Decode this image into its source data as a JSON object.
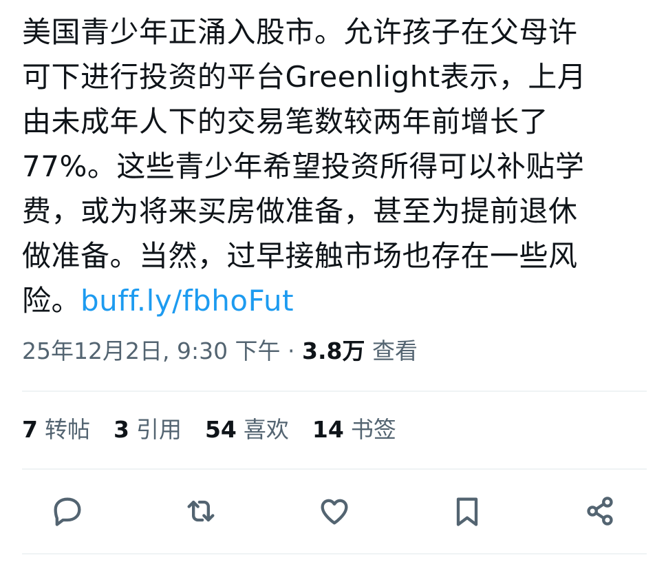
{
  "tweet": {
    "lines": [
      "美国青少年正涌入股市。允许孩子在父母许",
      "可下进行投资的平台Greenlight表示，上月",
      "由未成年人下的交易笔数较两年前增长了",
      "77%。这些青少年希望投资所得可以补贴学",
      "费，或为将来买房做准备，甚至为提前退休",
      "做准备。当然，过早接触市场也存在一些风"
    ],
    "last_line_prefix": "险。",
    "link_text": "buff.ly/fbhoFut"
  },
  "meta": {
    "timestamp": "25年12月2日, 9:30 下午",
    "separator": " · ",
    "views_count": "3.8万",
    "views_label": "查看"
  },
  "stats": [
    {
      "count": "7",
      "label": "转帖"
    },
    {
      "count": "3",
      "label": "引用"
    },
    {
      "count": "54",
      "label": "喜欢"
    },
    {
      "count": "14",
      "label": "书签"
    }
  ],
  "actions": [
    {
      "icon": "reply-icon"
    },
    {
      "icon": "retweet-icon"
    },
    {
      "icon": "like-icon"
    },
    {
      "icon": "bookmark-icon"
    },
    {
      "icon": "share-icon"
    }
  ],
  "colors": {
    "text": "#0f1419",
    "secondary": "#536471",
    "link": "#1d9bf0",
    "divider": "#eff3f4"
  }
}
